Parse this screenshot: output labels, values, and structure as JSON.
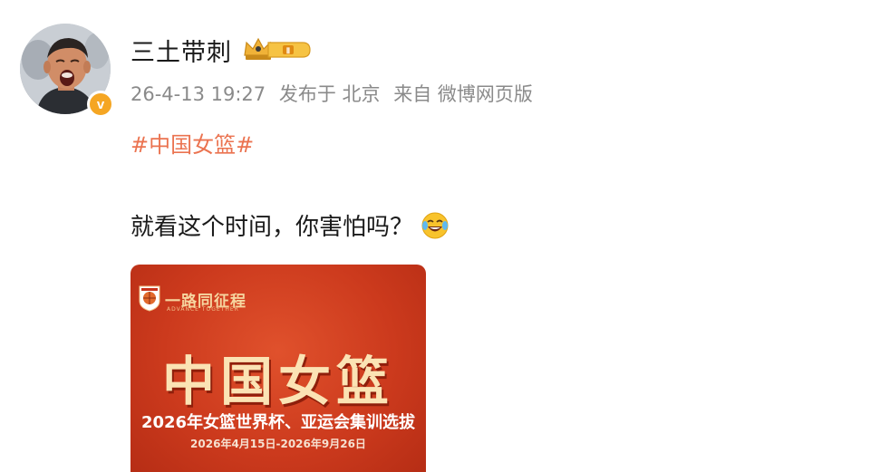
{
  "post": {
    "username": "三土带刺",
    "meta": {
      "time": "26-4-13 19:27",
      "posted_from": "发布于 北京",
      "source": "来自 微博网页版"
    },
    "hashtag": "#中国女篮#",
    "content": "就看这个时间，你害怕吗？",
    "badge_level": "Ⅱ",
    "verified_mark": "v",
    "icons": {
      "crown_badge": "crown-icon",
      "verified": "verified-icon",
      "emoji": "laugh-cry-emoji-icon"
    }
  },
  "image_card": {
    "logo_text": "一路同征程",
    "logo_subtitle": "ADVANCE TOGETHER",
    "title": "中国女篮",
    "subtitle": "2026年女篮世界杯、亚运会集训选拔",
    "dates": "2026年4月15日-2026年9月26日"
  },
  "colors": {
    "hashtag": "#eb7350",
    "meta_gray": "#8a8a8a",
    "card_red": "#cc3a1d",
    "card_gold": "#fbe3b4",
    "verified_orange": "#f5a623"
  }
}
